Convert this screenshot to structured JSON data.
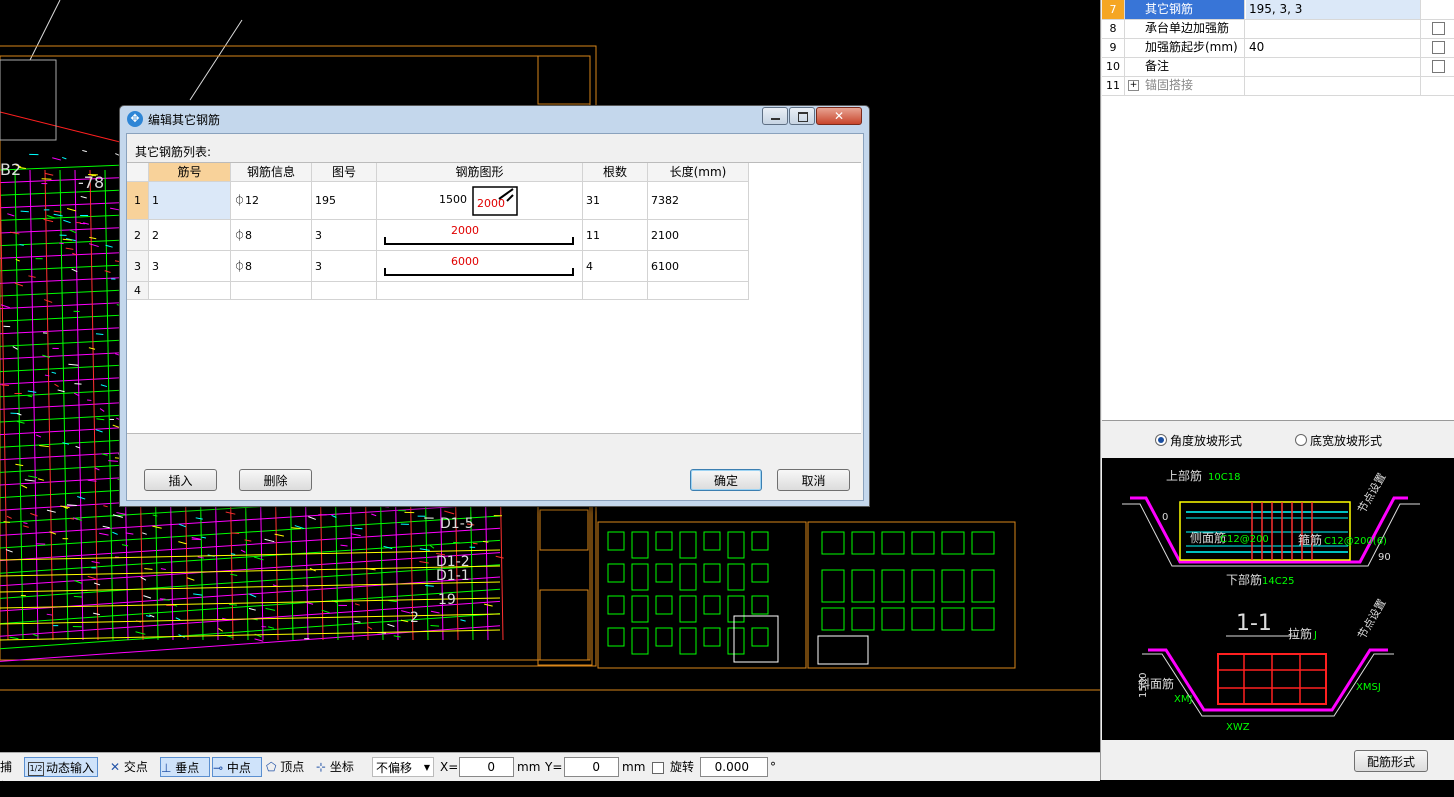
{
  "cad": {
    "labels": [
      "B2",
      "-78",
      "D1-5",
      "D1-1",
      "D1-2",
      "19",
      "2"
    ],
    "preview_labels": {
      "top_bar": "上部筋",
      "top_bar_spec": "10C18",
      "side_bar": "侧面筋",
      "side_bar_spec": "C12@200",
      "stirrup": "箍筋",
      "stirrup_spec": "C12@200(6)",
      "bottom_bar": "下部筋",
      "bottom_bar_spec": "14C25",
      "section": "1-1",
      "tie": "拉筋",
      "tie_spec": "J",
      "slope_bar": "斜面筋",
      "node_setting": "节点设置",
      "angle": "90",
      "h1500": "1500",
      "xmj": "XMJ",
      "xmsj": "XMSJ",
      "xwz": "XWZ",
      "zero": "0"
    }
  },
  "dialog": {
    "title": "编辑其它钢筋",
    "list_label": "其它钢筋列表:",
    "columns": [
      "筋号",
      "钢筋信息",
      "图号",
      "钢筋图形",
      "根数",
      "长度(mm)"
    ],
    "rows": [
      {
        "idx": "1",
        "no": "1",
        "info": "⏀12",
        "fig": "195",
        "shape_a": "1500",
        "shape_b": "2000",
        "count": "31",
        "length": "7382"
      },
      {
        "idx": "2",
        "no": "2",
        "info": "⏀8",
        "fig": "3",
        "shape_b": "2000",
        "count": "11",
        "length": "2100"
      },
      {
        "idx": "3",
        "no": "3",
        "info": "⏀8",
        "fig": "3",
        "shape_b": "6000",
        "count": "4",
        "length": "6100"
      },
      {
        "idx": "4",
        "no": "",
        "info": "",
        "fig": "",
        "shape_b": "",
        "count": "",
        "length": ""
      }
    ],
    "buttons": {
      "insert": "插入",
      "delete": "删除",
      "ok": "确定",
      "cancel": "取消"
    }
  },
  "properties": {
    "rows": [
      {
        "num": "7",
        "name": "其它钢筋",
        "value": "195, 3, 3",
        "checkbox": false,
        "selected": true
      },
      {
        "num": "8",
        "name": "承台单边加强筋",
        "value": "",
        "checkbox": true,
        "selected": false
      },
      {
        "num": "9",
        "name": "加强筋起步(mm)",
        "value": "40",
        "checkbox": true,
        "selected": false
      },
      {
        "num": "10",
        "name": "备注",
        "value": "",
        "checkbox": true,
        "selected": false
      },
      {
        "num": "11",
        "name": "锚固搭接",
        "value": "",
        "checkbox": false,
        "selected": false,
        "expand": "+"
      }
    ],
    "radio_angle": "角度放坡形式",
    "radio_width": "底宽放坡形式",
    "config_button": "配筋形式"
  },
  "statusbar": {
    "snap": "捕捉",
    "dynamic_input": "动态输入",
    "intersection": "交点",
    "perpendicular": "垂点",
    "midpoint": "中点",
    "vertex": "顶点",
    "coordinate": "坐标",
    "offset": "不偏移",
    "x_label": "X=",
    "x_value": "0",
    "y_label": "Y=",
    "y_value": "0",
    "unit": "mm",
    "rotate": "旋转",
    "rotate_value": "0.000",
    "degree": "°"
  },
  "colors": {
    "cad_bg": "#000000",
    "drawing_orange": "#d9861a",
    "drawing_green": "#00ff00",
    "drawing_magenta": "#ff00ff",
    "drawing_red": "#ff0000",
    "selection_blue": "#3875d7"
  }
}
